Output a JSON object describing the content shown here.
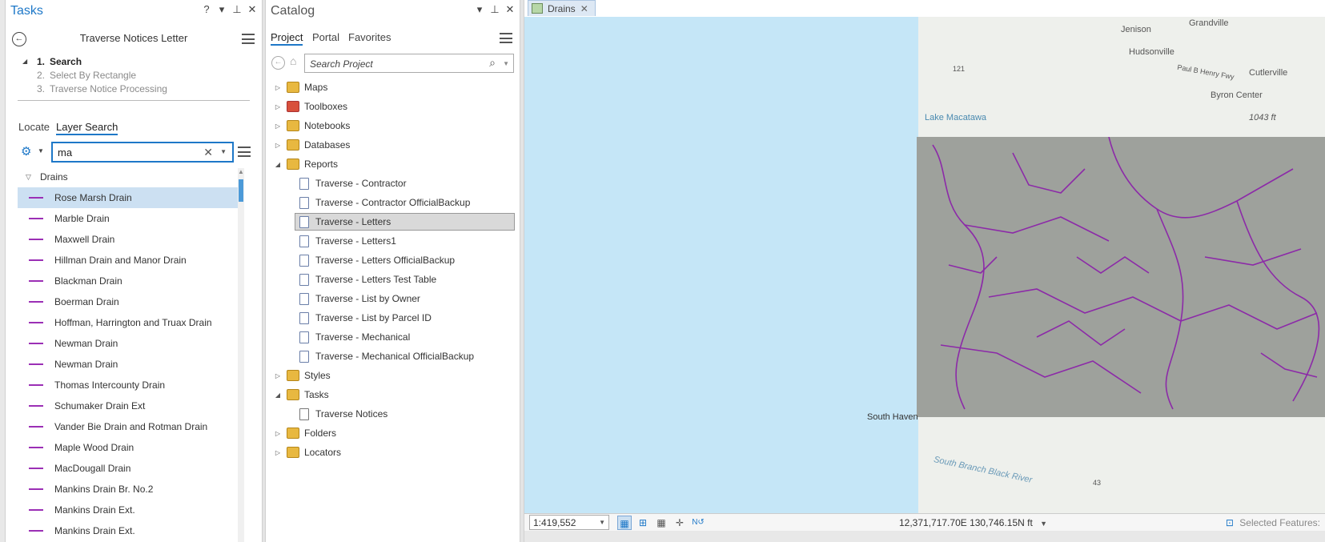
{
  "tasks_pane": {
    "title": "Tasks",
    "controls": [
      "?",
      "▾",
      "⊥",
      "✕"
    ],
    "task_name": "Traverse Notices Letter",
    "steps": [
      {
        "num": "1.",
        "label": "Search",
        "active": true
      },
      {
        "num": "2.",
        "label": "Select By Rectangle",
        "active": false
      },
      {
        "num": "3.",
        "label": "Traverse Notice Processing",
        "active": false
      }
    ],
    "tabs": {
      "locate": "Locate",
      "layer_search": "Layer Search"
    },
    "search_value": "ma",
    "group_label": "Drains",
    "results": [
      "Rose Marsh Drain",
      "Marble Drain",
      "Maxwell Drain",
      "Hillman Drain and Manor Drain",
      "Blackman Drain",
      "Boerman Drain",
      "Hoffman, Harrington and Truax Drain",
      "Newman Drain",
      "Newman Drain",
      "Thomas Intercounty Drain",
      "Schumaker Drain Ext",
      "Vander Bie Drain and Rotman Drain",
      "Maple Wood Drain",
      "MacDougall Drain",
      "Mankins Drain Br. No.2",
      "Mankins Drain Ext.",
      "Mankins Drain Ext."
    ],
    "selected_result_index": 0,
    "symbol_color": "#9b2fb5"
  },
  "catalog_pane": {
    "title": "Catalog",
    "controls": [
      "▾",
      "⊥",
      "✕"
    ],
    "tabs": {
      "project": "Project",
      "portal": "Portal",
      "favorites": "Favorites"
    },
    "search_placeholder": "Search Project",
    "tree": {
      "maps": "Maps",
      "toolboxes": "Toolboxes",
      "notebooks": "Notebooks",
      "databases": "Databases",
      "reports": "Reports",
      "report_items": [
        "Traverse - Contractor",
        "Traverse - Contractor OfficialBackup",
        "Traverse - Letters",
        "Traverse - Letters1",
        "Traverse - Letters OfficialBackup",
        "Traverse - Letters Test Table",
        "Traverse - List by Owner",
        "Traverse - List by Parcel ID",
        "Traverse - Mechanical",
        "Traverse - Mechanical OfficialBackup"
      ],
      "selected_report_index": 2,
      "styles": "Styles",
      "tasks": "Tasks",
      "task_items": [
        "Traverse Notices"
      ],
      "folders": "Folders",
      "locators": "Locators"
    }
  },
  "map_view": {
    "tab_label": "Drains",
    "scale": "1:419,552",
    "coordinates": "12,371,717.70E 130,746.15N ft",
    "selected_features": "Selected Features:",
    "place_labels": {
      "jenison": "Jenison",
      "grandville": "Grandville",
      "hudsonville": "Hudsonville",
      "cutlerville": "Cutlerville",
      "byron_center": "Byron Center",
      "elevation": "1043 ft",
      "lake_macatawa": "Lake Macatawa",
      "south_haven": "South Haven",
      "black_river": "South Branch Black River",
      "route_43": "43",
      "route_121": "121",
      "paul_b_henry_fwy": "Paul B Henry Fwy"
    },
    "colors": {
      "water": "#c5e6f7",
      "drains": "#8c2aa8",
      "parcels": "#9ea19c"
    }
  }
}
